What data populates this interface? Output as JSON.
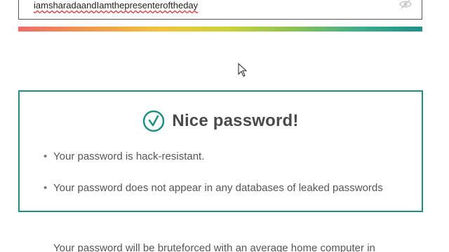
{
  "password_field": {
    "value": "iamsharadaandIamthepresenteroftheday",
    "toggle_icon": "eye-off-icon"
  },
  "strength_meter": {
    "colors": [
      "#ee6b6b",
      "#f09a4a",
      "#f2c23c",
      "#c9d13a",
      "#8cc152",
      "#3fae8a",
      "#1f8f8a"
    ]
  },
  "result": {
    "icon": "check-circle-icon",
    "accent_color": "#1f8f80",
    "title": "Nice password!",
    "items": [
      "Your password is hack-resistant.",
      "Your password does not appear in any databases of leaked passwords"
    ]
  },
  "bruteforce_text": "Your password will be bruteforced with an average home computer in"
}
